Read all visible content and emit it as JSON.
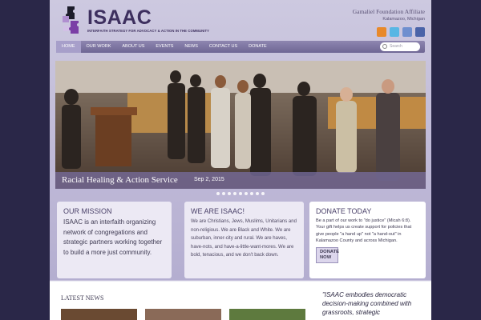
{
  "site": {
    "logo_text": "ISAAC",
    "tagline": "INTERFAITH STRATEGY FOR ADVOCACY & ACTION IN THE COMMUNITY",
    "affiliate": "Gamaliel Foundation Affiliate",
    "location": "Kalamazoo, Michigan"
  },
  "social": [
    "rss-icon",
    "twitter-icon",
    "flickr-icon",
    "facebook-icon"
  ],
  "nav": {
    "items": [
      "HOME",
      "OUR WORK",
      "ABOUT US",
      "EVENTS",
      "NEWS",
      "CONTACT US",
      "DONATE"
    ],
    "search_placeholder": "Search"
  },
  "slider": {
    "title": "Racial Healing & Action Service",
    "date": "Sep 2, 2015",
    "dots": 9
  },
  "mission": {
    "title": "OUR MISSION",
    "text": "ISAAC is an interfaith organizing network of congregations and strategic partners working together to build a more just community."
  },
  "we_are": {
    "title": "WE ARE ISAAC!",
    "text": "We are Christians, Jews, Muslims, Unitarians and non-religious. We are Black and White. We are suburban, inner-city and rural. We are haves, have-nots, and have-a-little-want-mores. We are bold, tenacious, and we don't back down."
  },
  "donate": {
    "title": "DONATE TODAY",
    "text": "Be a part of our work to \"do justice\" (Micah 6:8). Your gift helps us create support for policies that give people \"a hand up\" not \"a hand-out\" in Kalamazoo County and across Michigan.",
    "button": "DONATE NOW"
  },
  "latest": {
    "title": "LATEST NEWS"
  },
  "quote": {
    "text": "\"ISAAC embodies democratic decision-making combined with grassroots, strategic"
  },
  "colors": {
    "accent": "#6e6694",
    "background": "#2a2748",
    "text": "#3e3a52"
  }
}
